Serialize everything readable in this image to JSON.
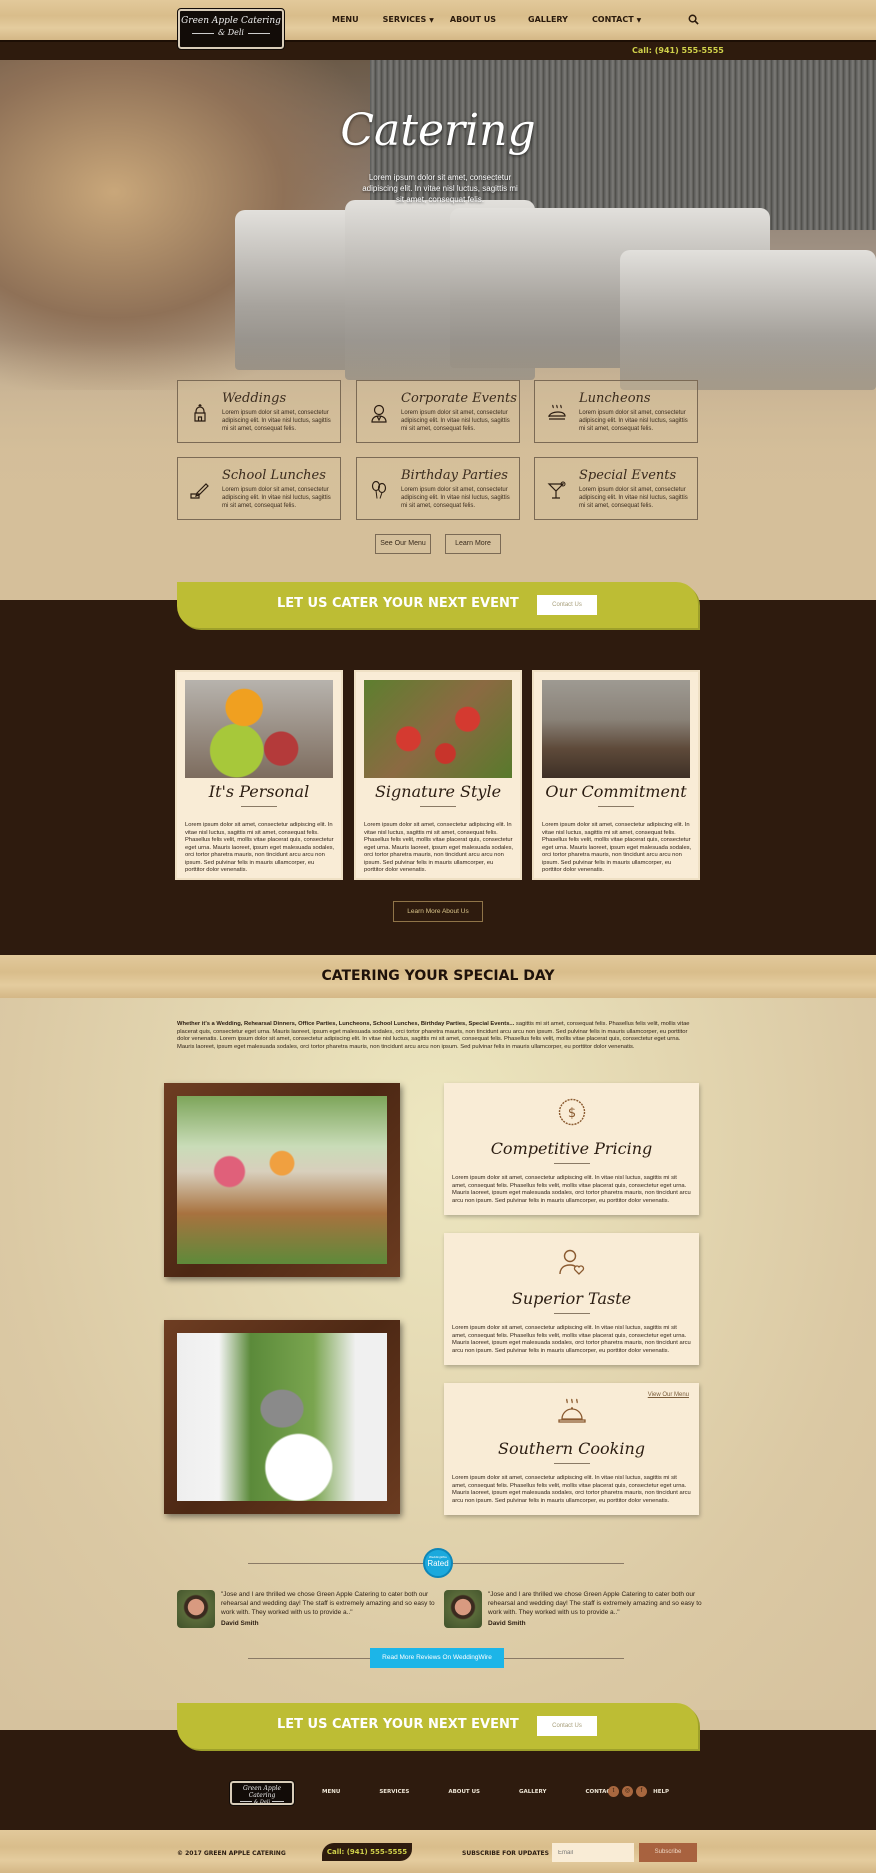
{
  "brand": {
    "logo_line1": "Green Apple Catering",
    "logo_line2": "& Deli"
  },
  "nav": {
    "items": [
      {
        "label": "MENU",
        "has_dropdown": false
      },
      {
        "label": "SERVICES",
        "has_dropdown": true
      },
      {
        "label": "ABOUT US",
        "has_dropdown": false
      },
      {
        "label": "GALLERY",
        "has_dropdown": false
      },
      {
        "label": "CONTACT",
        "has_dropdown": true
      }
    ],
    "caret": "▼",
    "search_icon": "search-icon"
  },
  "topbar": {
    "call": "Call: (941) 555-5555"
  },
  "hero": {
    "title": "Catering",
    "subtitle": "Lorem ipsum dolor sit amet, consectetur adipiscing elit. In vitae nisl luctus, sagittis mi sit amet, consequat felis."
  },
  "services": [
    {
      "title": "Weddings",
      "icon": "chapel-icon",
      "desc": "Lorem ipsum dolor sit amet, consectetur adipiscing elit. In vitae nisl luctus, sagittis mi sit amet, consequat felis."
    },
    {
      "title": "Corporate Events",
      "icon": "businesswoman-icon",
      "desc": "Lorem ipsum dolor sit amet, consectetur adipiscing elit. In vitae nisl luctus, sagittis mi sit amet, consequat felis."
    },
    {
      "title": "Luncheons",
      "icon": "hot-dish-icon",
      "desc": "Lorem ipsum dolor sit amet, consectetur adipiscing elit. In vitae nisl luctus, sagittis mi sit amet, consequat felis."
    },
    {
      "title": "School Lunches",
      "icon": "pencil-icon",
      "desc": "Lorem ipsum dolor sit amet, consectetur adipiscing elit. In vitae nisl luctus, sagittis mi sit amet, consequat felis."
    },
    {
      "title": "Birthday Parties",
      "icon": "balloons-icon",
      "desc": "Lorem ipsum dolor sit amet, consectetur adipiscing elit. In vitae nisl luctus, sagittis mi sit amet, consequat felis."
    },
    {
      "title": "Special Events",
      "icon": "cocktail-icon",
      "desc": "Lorem ipsum dolor sit amet, consectetur adipiscing elit. In vitae nisl luctus, sagittis mi sit amet, consequat felis."
    }
  ],
  "hero_buttons": {
    "menu": "See Our Menu",
    "learn": "Learn More"
  },
  "cta": {
    "text": "LET US CATER YOUR NEXT EVENT",
    "button": "Contact Us"
  },
  "features": [
    {
      "title": "It's Personal",
      "desc": "Lorem ipsum dolor sit amet, consectetur adipiscing elit. In vitae nisl luctus, sagittis mi sit amet, consequat felis. Phasellus felis velit, mollis vitae placerat quis, consectetur eget urna. Mauris laoreet, ipsum eget malesuada sodales, orci tortor pharetra mauris, non tincidunt arcu arcu non ipsum. Sed pulvinar felis in mauris ullamcorper, eu porttitor dolor venenatis."
    },
    {
      "title": "Signature Style",
      "desc": "Lorem ipsum dolor sit amet, consectetur adipiscing elit. In vitae nisl luctus, sagittis mi sit amet, consequat felis. Phasellus felis velit, mollis vitae placerat quis, consectetur eget urna. Mauris laoreet, ipsum eget malesuada sodales, orci tortor pharetra mauris, non tincidunt arcu arcu non ipsum. Sed pulvinar felis in mauris ullamcorper, eu porttitor dolor venenatis."
    },
    {
      "title": "Our Commitment",
      "desc": "Lorem ipsum dolor sit amet, consectetur adipiscing elit. In vitae nisl luctus, sagittis mi sit amet, consequat felis. Phasellus felis velit, mollis vitae placerat quis, consectetur eget urna. Mauris laoreet, ipsum eget malesuada sodales, orci tortor pharetra mauris, non tincidunt arcu arcu non ipsum. Sed pulvinar felis in mauris ullamcorper, eu porttitor dolor venenatis."
    }
  ],
  "learn_about": "Learn More About Us",
  "special_day": {
    "title": "CATERING YOUR SPECIAL DAY",
    "intro_bold": "Whether it's a Wedding, Rehearsal Dinners, Office Parties, Luncheons, School Lunches, Birthday Parties, Special Events...",
    "intro_rest": " sagittis mi sit amet, consequat felis. Phasellus felis velit, mollis vitae placerat quis, consectetur eget urna. Mauris laoreet, ipsum eget malesuada sodales, orci tortor pharetra mauris, non tincidunt arcu arcu non ipsum. Sed pulvinar felis in mauris ullamcorper, eu porttitor dolor venenatis. Lorem ipsum dolor sit amet, consectetur adipiscing elit. In vitae nisl luctus, sagittis mi sit amet, consequat felis. Phasellus felis velit, mollis vitae placerat quis, consectetur eget urna. Mauris laoreet, ipsum eget malesuada sodales, orci tortor pharetra mauris, non tincidunt arcu arcu non ipsum. Sed pulvinar felis in mauris ullamcorper, eu porttitor dolor venenatis.",
    "cards": [
      {
        "title": "Competitive Pricing",
        "icon": "dollar-badge-icon",
        "desc": "Lorem ipsum dolor sit amet, consectetur adipiscing elit. In vitae nisl luctus, sagittis mi sit amet, consequat felis. Phasellus felis velit, mollis vitae placerat quis, consectetur eget urna. Mauris laoreet, ipsum eget malesuada sodales, orci tortor pharetra mauris, non tincidunt arcu arcu non ipsum. Sed pulvinar felis in mauris ullamcorper, eu porttitor dolor venenatis."
      },
      {
        "title": "Superior Taste",
        "icon": "user-heart-icon",
        "desc": "Lorem ipsum dolor sit amet, consectetur adipiscing elit. In vitae nisl luctus, sagittis mi sit amet, consequat felis. Phasellus felis velit, mollis vitae placerat quis, consectetur eget urna. Mauris laoreet, ipsum eget malesuada sodales, orci tortor pharetra mauris, non tincidunt arcu arcu non ipsum. Sed pulvinar felis in mauris ullamcorper, eu porttitor dolor venenatis."
      },
      {
        "title": "Southern Cooking",
        "icon": "cloche-icon",
        "link": "View Our Menu",
        "desc": "Lorem ipsum dolor sit amet, consectetur adipiscing elit. In vitae nisl luctus, sagittis mi sit amet, consequat felis. Phasellus felis velit, mollis vitae placerat quis, consectetur eget urna. Mauris laoreet, ipsum eget malesuada sodales, orci tortor pharetra mauris, non tincidunt arcu arcu non ipsum. Sed pulvinar felis in mauris ullamcorper, eu porttitor dolor venenatis."
      }
    ]
  },
  "reviews": {
    "badge_small": "WeddingWire",
    "badge_main": "Rated",
    "items": [
      {
        "quote": "\"Jose and I are thrilled we chose Green Apple Catering to cater both our rehearsal and wedding day! The staff is extremely amazing and so easy to work with. They worked with us to provide a..\"",
        "name": "David Smith"
      },
      {
        "quote": "\"Jose and I are thrilled we chose Green Apple Catering to cater both our rehearsal and wedding day! The staff is extremely amazing and so easy to work with. They worked with us to provide a..\"",
        "name": "David Smith"
      }
    ],
    "button": "Read More Reviews On WeddingWire"
  },
  "footer": {
    "nav": [
      "MENU",
      "SERVICES",
      "ABOUT US",
      "GALLERY",
      "CONTACT",
      "HELP"
    ],
    "social": [
      {
        "icon": "twitter-icon",
        "glyph": "t"
      },
      {
        "icon": "instagram-icon",
        "glyph": "◎"
      },
      {
        "icon": "facebook-icon",
        "glyph": "f"
      }
    ],
    "copyright": "© 2017 GREEN APPLE CATERING",
    "call": "Call: (941) 555-5555",
    "subscribe_label": "SUBSCRIBE FOR UPDATES",
    "email_placeholder": "Email",
    "subscribe_button": "Subscribe"
  },
  "colors": {
    "accent_green": "#bdbd34",
    "dark_brown": "#2e1b0e",
    "cream": "#f9ecd6",
    "weddingwire_blue": "#1cb5e8",
    "subscribe_brown": "#a8623f",
    "call_yellow": "#cfd04a"
  }
}
